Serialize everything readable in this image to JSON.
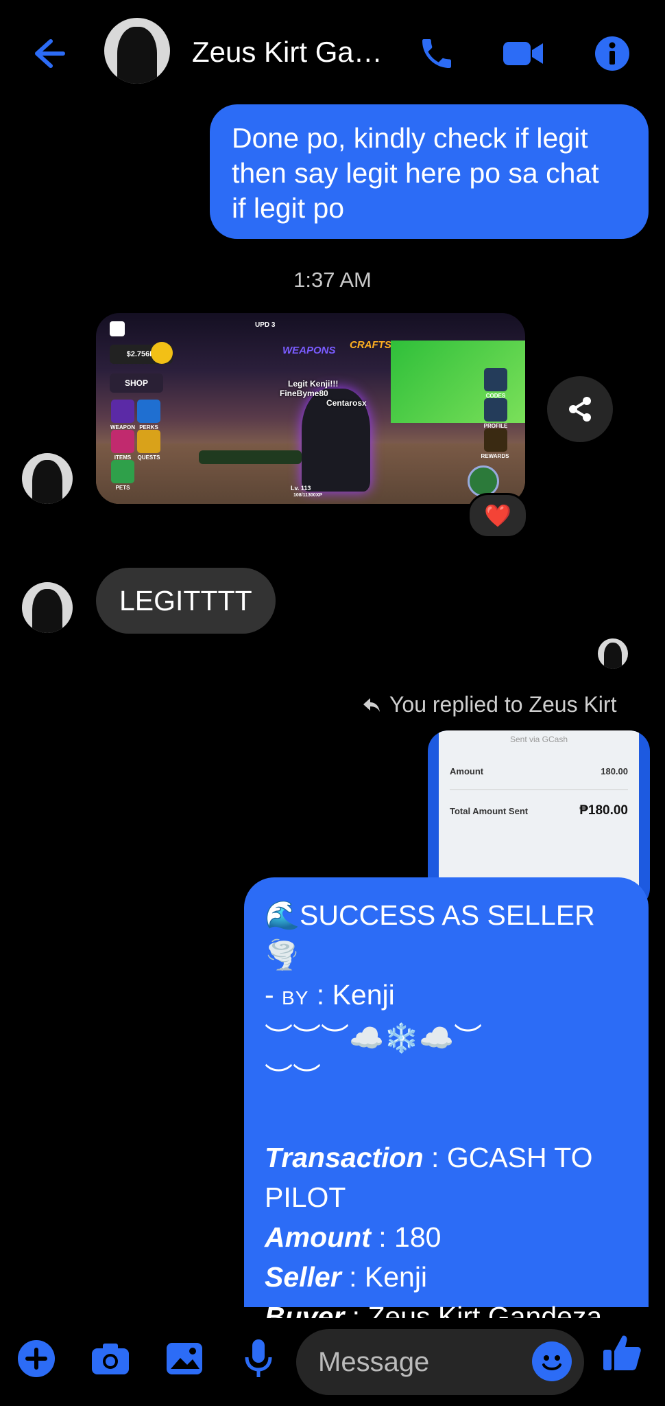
{
  "header": {
    "contact_name": "Zeus Kirt Ga…",
    "icons": [
      "back-arrow-icon",
      "phone-icon",
      "video-icon",
      "info-icon"
    ],
    "accent": "#2c6cf6"
  },
  "messages": {
    "outgoing_1": {
      "line1": "Done po, kindly check if legit",
      "line2": "then say legit here po sa chat",
      "line3": "if legit po"
    },
    "timestamp": "1:37 AM",
    "game_screenshot": {
      "money": "$2.756M",
      "shop": "SHOP",
      "weapon": "WEAPON",
      "perks": "PERKS",
      "items": "ITEMS",
      "quests": "QUESTS",
      "pets": "PETS",
      "upd": "UPD 3",
      "weapons_banner": "WEAPONS",
      "crafts_banner": "CRAFTS",
      "player1": "Legit Kenji!!!",
      "player2": "FineByme80",
      "player3": "Centarosx",
      "codes": "CODES",
      "profile": "PROFILE",
      "rewards": "REWARDS",
      "level": "Lv. 113",
      "xp": "108/11300XP"
    },
    "reaction": "❤️",
    "incoming_legit": "LEGITTTT",
    "reply_label": "You replied to Zeus Kirt",
    "receipt": {
      "sent_via": "Sent via GCash",
      "amount_label": "Amount",
      "amount_value": "180.00",
      "total_label": "Total Amount Sent",
      "total_value": "₱180.00"
    },
    "outgoing_2": {
      "title": "🌊SUCCESS AS SELLER🌪️",
      "by_prefix": "- ",
      "by_label": "BY",
      "by_value": " : Kenji",
      "deco1": "︶︶︶☁️❄️☁️︶",
      "deco2": "︶︶",
      "transaction_label": "Transaction",
      "transaction_value": " : GCASH TO PILOT",
      "amount_label": "Amount",
      "amount_value": " : 180",
      "seller_label": "Seller",
      "seller_value": " : Kenji",
      "buyer_label": "Buyer",
      "buyer_value": " : Zeus Kirt Gandeza"
    }
  },
  "composer": {
    "placeholder": "Message",
    "icons": [
      "plus-icon",
      "camera-icon",
      "gallery-icon",
      "microphone-icon",
      "emoji-icon",
      "thumbs-up-icon"
    ]
  }
}
